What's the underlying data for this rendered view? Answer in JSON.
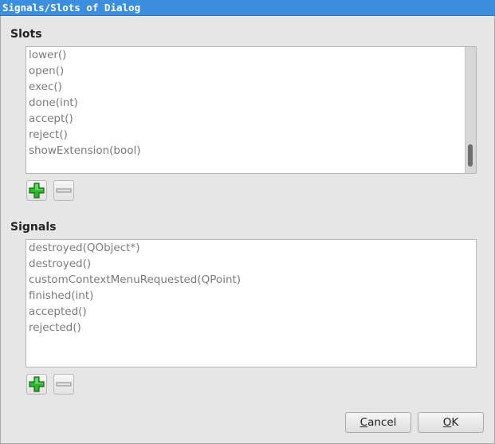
{
  "window": {
    "title": "Signals/Slots of Dialog"
  },
  "slots": {
    "label": "Slots",
    "items": [
      "lower()",
      "open()",
      "exec()",
      "done(int)",
      "accept()",
      "reject()",
      "showExtension(bool)"
    ],
    "scroll_position": 0.95
  },
  "signals": {
    "label": "Signals",
    "items": [
      "destroyed(QObject*)",
      "destroyed()",
      "customContextMenuRequested(QPoint)",
      "finished(int)",
      "accepted()",
      "rejected()"
    ]
  },
  "buttons": {
    "cancel": {
      "mnemonic": "C",
      "rest": "ancel"
    },
    "ok": {
      "mnemonic": "O",
      "rest": "K"
    }
  },
  "icons": {
    "add": "plus-icon",
    "remove": "minus-icon"
  },
  "colors": {
    "titlebar": "#3c8fdf",
    "plus_green": "#2db62d",
    "list_text": "#7b7b7b"
  }
}
